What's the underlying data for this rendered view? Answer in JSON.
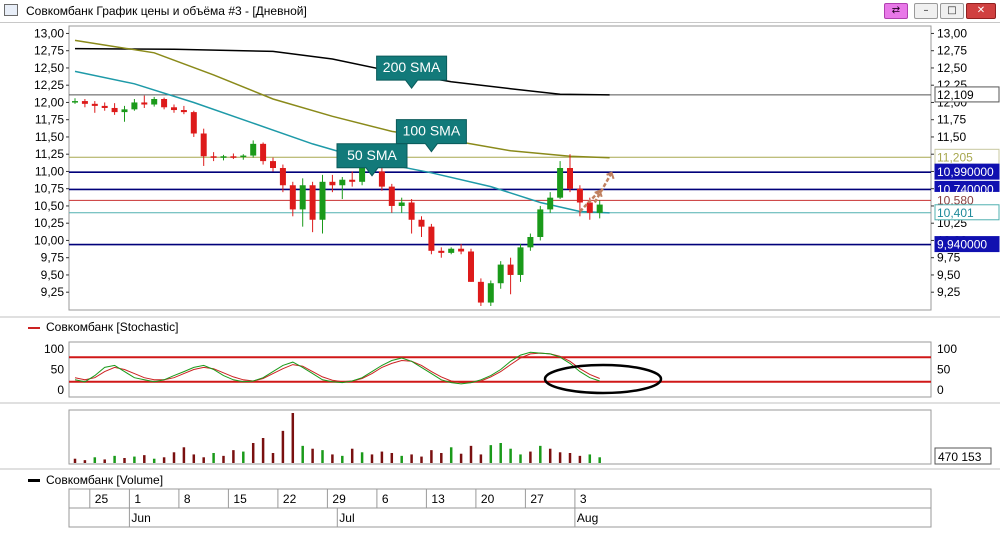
{
  "window": {
    "title": "Совкомбанк График цены и объёма #3 - [Дневной]",
    "buttons": {
      "pin": "⇄",
      "minimize": "–",
      "maximize": "□",
      "close": "✕"
    }
  },
  "colors": {
    "up": "#1a9a1a",
    "down": "#dd1a1a",
    "sma50": "#1e9aa8",
    "sma100": "#8a8a1a",
    "sma200": "#000000",
    "hline_blue": "#00007a",
    "hline_red": "#c83030",
    "hline_olive": "#a8a850",
    "hline_teal": "#50b0b0",
    "callout": "#127a7a",
    "stoch_k": "#1a9a1a",
    "stoch_d": "#cc2222",
    "volume_down": "#7a1010",
    "volume_up": "#1a9a1a",
    "arrow": "#c08060"
  },
  "price_axis": {
    "ticks": [
      "13,00",
      "12,75",
      "12,50",
      "12,25",
      "12,00",
      "11,75",
      "11,50",
      "11,25",
      "11,00",
      "10,75",
      "10,50",
      "10,25",
      "10,00",
      "9,75",
      "9,50",
      "9,25"
    ]
  },
  "price_labels": [
    {
      "text": "12,109",
      "value": 12.109,
      "style": "plain"
    },
    {
      "text": "11,205",
      "value": 11.205,
      "style": "olive"
    },
    {
      "text": "10,990000",
      "value": 10.99,
      "style": "blue"
    },
    {
      "text": "10,740000",
      "value": 10.74,
      "style": "blue"
    },
    {
      "text": "10,580",
      "value": 10.58,
      "style": "redtext"
    },
    {
      "text": "10,401",
      "value": 10.401,
      "style": "teal"
    },
    {
      "text": "9,940000",
      "value": 9.94,
      "style": "blue"
    }
  ],
  "callouts": [
    {
      "text": "200 SMA",
      "date_index": 34,
      "price": 12.12
    },
    {
      "text": "100 SMA",
      "date_index": 36,
      "price": 11.2
    },
    {
      "text": "50 SMA",
      "date_index": 30,
      "price": 10.85
    }
  ],
  "stochastic": {
    "label": "Совкомбанк [Stochastic]",
    "ticks": [
      "100",
      "50",
      "0"
    ],
    "overbought": 80,
    "oversold": 20
  },
  "volume": {
    "label": "Совкомбанк [Volume]",
    "last_value": "470 153"
  },
  "time_axis": {
    "days": [
      {
        "label": "25",
        "index": 2
      },
      {
        "label": "1",
        "index": 6
      },
      {
        "label": "8",
        "index": 11
      },
      {
        "label": "15",
        "index": 16
      },
      {
        "label": "22",
        "index": 21
      },
      {
        "label": "29",
        "index": 26
      },
      {
        "label": "6",
        "index": 31
      },
      {
        "label": "13",
        "index": 36
      },
      {
        "label": "20",
        "index": 41
      },
      {
        "label": "27",
        "index": 46
      },
      {
        "label": "3",
        "index": 51
      }
    ],
    "months": [
      {
        "label": "Jun",
        "index": 6
      },
      {
        "label": "Jul",
        "index": 27
      },
      {
        "label": "Aug",
        "index": 51
      }
    ]
  },
  "chart_data": {
    "type": "candlestick",
    "title": "Совкомбанк График цены и объёма #3 - [Дневной]",
    "y_range": [
      9.05,
      13.05
    ],
    "candles": [
      [
        12.0,
        12.06,
        11.98,
        12.02
      ],
      [
        12.02,
        12.05,
        11.93,
        11.98
      ],
      [
        11.98,
        12.02,
        11.85,
        11.95
      ],
      [
        11.95,
        12.0,
        11.88,
        11.92
      ],
      [
        11.92,
        11.99,
        11.82,
        11.86
      ],
      [
        11.86,
        11.95,
        11.72,
        11.9
      ],
      [
        11.9,
        12.05,
        11.88,
        12.0
      ],
      [
        12.0,
        12.1,
        11.92,
        11.97
      ],
      [
        11.97,
        12.08,
        11.94,
        12.05
      ],
      [
        12.05,
        12.07,
        11.9,
        11.93
      ],
      [
        11.93,
        11.97,
        11.85,
        11.89
      ],
      [
        11.89,
        11.95,
        11.83,
        11.86
      ],
      [
        11.86,
        11.88,
        11.5,
        11.55
      ],
      [
        11.55,
        11.62,
        11.08,
        11.22
      ],
      [
        11.22,
        11.28,
        11.15,
        11.2
      ],
      [
        11.2,
        11.24,
        11.16,
        11.22
      ],
      [
        11.22,
        11.26,
        11.18,
        11.21
      ],
      [
        11.21,
        11.25,
        11.17,
        11.23
      ],
      [
        11.23,
        11.45,
        11.2,
        11.4
      ],
      [
        11.4,
        11.42,
        11.1,
        11.15
      ],
      [
        11.15,
        11.2,
        11.0,
        11.05
      ],
      [
        11.05,
        11.1,
        10.7,
        10.8
      ],
      [
        10.8,
        10.85,
        10.35,
        10.45
      ],
      [
        10.45,
        10.9,
        10.2,
        10.8
      ],
      [
        10.8,
        10.85,
        10.12,
        10.3
      ],
      [
        10.3,
        10.95,
        10.1,
        10.85
      ],
      [
        10.85,
        10.95,
        10.7,
        10.8
      ],
      [
        10.8,
        10.92,
        10.6,
        10.88
      ],
      [
        10.88,
        11.0,
        10.78,
        10.85
      ],
      [
        10.85,
        11.15,
        10.8,
        11.05
      ],
      [
        11.05,
        11.25,
        10.95,
        11.0
      ],
      [
        11.0,
        11.15,
        10.72,
        10.78
      ],
      [
        10.78,
        10.82,
        10.4,
        10.5
      ],
      [
        10.5,
        10.62,
        10.4,
        10.55
      ],
      [
        10.55,
        10.6,
        10.1,
        10.3
      ],
      [
        10.3,
        10.35,
        10.05,
        10.2
      ],
      [
        10.2,
        10.24,
        9.8,
        9.85
      ],
      [
        9.85,
        9.9,
        9.75,
        9.82
      ],
      [
        9.82,
        9.9,
        9.8,
        9.88
      ],
      [
        9.88,
        9.95,
        9.8,
        9.84
      ],
      [
        9.84,
        9.88,
        9.4,
        9.4
      ],
      [
        9.4,
        9.45,
        9.05,
        9.1
      ],
      [
        9.1,
        9.42,
        9.05,
        9.38
      ],
      [
        9.38,
        9.7,
        9.3,
        9.65
      ],
      [
        9.65,
        9.75,
        9.22,
        9.5
      ],
      [
        9.5,
        9.95,
        9.4,
        9.9
      ],
      [
        9.9,
        10.1,
        9.85,
        10.05
      ],
      [
        10.05,
        10.5,
        10.0,
        10.45
      ],
      [
        10.45,
        10.7,
        10.4,
        10.62
      ],
      [
        10.62,
        11.15,
        10.6,
        11.05
      ],
      [
        11.05,
        11.25,
        10.7,
        10.75
      ],
      [
        10.75,
        10.8,
        10.35,
        10.55
      ],
      [
        10.55,
        10.62,
        10.3,
        10.4
      ],
      [
        10.4,
        10.58,
        10.32,
        10.52
      ]
    ],
    "sma": [
      {
        "name": "200 SMA",
        "points": [
          [
            0,
            12.78
          ],
          [
            10,
            12.77
          ],
          [
            20,
            12.74
          ],
          [
            26,
            12.63
          ],
          [
            32,
            12.45
          ],
          [
            38,
            12.3
          ],
          [
            44,
            12.2
          ],
          [
            49,
            12.12
          ],
          [
            54,
            12.11
          ]
        ]
      },
      {
        "name": "100 SMA",
        "points": [
          [
            0,
            12.9
          ],
          [
            8,
            12.72
          ],
          [
            14,
            12.4
          ],
          [
            20,
            12.05
          ],
          [
            26,
            11.8
          ],
          [
            32,
            11.58
          ],
          [
            38,
            11.45
          ],
          [
            44,
            11.3
          ],
          [
            50,
            11.22
          ],
          [
            54,
            11.2
          ]
        ]
      },
      {
        "name": "50 SMA",
        "points": [
          [
            0,
            12.45
          ],
          [
            6,
            12.27
          ],
          [
            12,
            12.0
          ],
          [
            18,
            11.7
          ],
          [
            24,
            11.4
          ],
          [
            30,
            11.15
          ],
          [
            36,
            10.98
          ],
          [
            42,
            10.78
          ],
          [
            47,
            10.55
          ],
          [
            51,
            10.42
          ],
          [
            54,
            10.4
          ]
        ]
      }
    ],
    "horizontal_lines": [
      12.109,
      11.205,
      10.99,
      10.74,
      10.58,
      10.401,
      9.94
    ],
    "stochastic": {
      "k": [
        25,
        20,
        35,
        55,
        60,
        45,
        30,
        25,
        20,
        25,
        35,
        45,
        55,
        60,
        50,
        35,
        25,
        20,
        22,
        30,
        45,
        60,
        68,
        55,
        40,
        25,
        20,
        18,
        22,
        30,
        45,
        60,
        72,
        78,
        70,
        55,
        40,
        25,
        18,
        15,
        18,
        25,
        35,
        50,
        70,
        85,
        92,
        90,
        88,
        80,
        65,
        45,
        30,
        22
      ],
      "d": [
        30,
        25,
        30,
        45,
        55,
        50,
        40,
        30,
        25,
        25,
        30,
        40,
        50,
        55,
        52,
        42,
        32,
        25,
        22,
        28,
        40,
        52,
        62,
        58,
        45,
        32,
        24,
        20,
        22,
        28,
        40,
        55,
        65,
        72,
        70,
        60,
        45,
        32,
        22,
        18,
        18,
        22,
        32,
        45,
        62,
        78,
        88,
        90,
        88,
        82,
        70,
        52,
        38,
        28
      ]
    },
    "volume": [
      6,
      4,
      8,
      5,
      10,
      7,
      9,
      11,
      6,
      8,
      15,
      22,
      12,
      8,
      14,
      10,
      18,
      16,
      28,
      35,
      14,
      45,
      70,
      24,
      20,
      18,
      12,
      10,
      20,
      15,
      12,
      16,
      14,
      10,
      12,
      9,
      18,
      14,
      22,
      13,
      24,
      12,
      25,
      28,
      20,
      12,
      16,
      24,
      20,
      15,
      14,
      10,
      12,
      8
    ],
    "volume_up": [
      false,
      false,
      true,
      false,
      true,
      false,
      true,
      false,
      true,
      false,
      false,
      false,
      false,
      false,
      true,
      false,
      false,
      true,
      false,
      false,
      false,
      false,
      false,
      true,
      false,
      true,
      false,
      true,
      false,
      true,
      false,
      false,
      false,
      true,
      false,
      false,
      false,
      false,
      true,
      false,
      false,
      false,
      true,
      true,
      true,
      true,
      false,
      true,
      false,
      false,
      false,
      false,
      true,
      true
    ]
  }
}
